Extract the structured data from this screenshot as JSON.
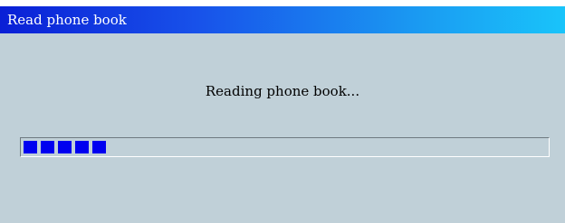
{
  "window": {
    "title": "Read phone book"
  },
  "dialog": {
    "message": "Reading phone book..."
  },
  "progress": {
    "percent": 16,
    "segments_filled": 5
  },
  "colors": {
    "title_bar_start": "#0a1fd6",
    "title_bar_end": "#19c4fa",
    "window_background": "#c0d0d8",
    "progress_segment": "#0000f0"
  }
}
